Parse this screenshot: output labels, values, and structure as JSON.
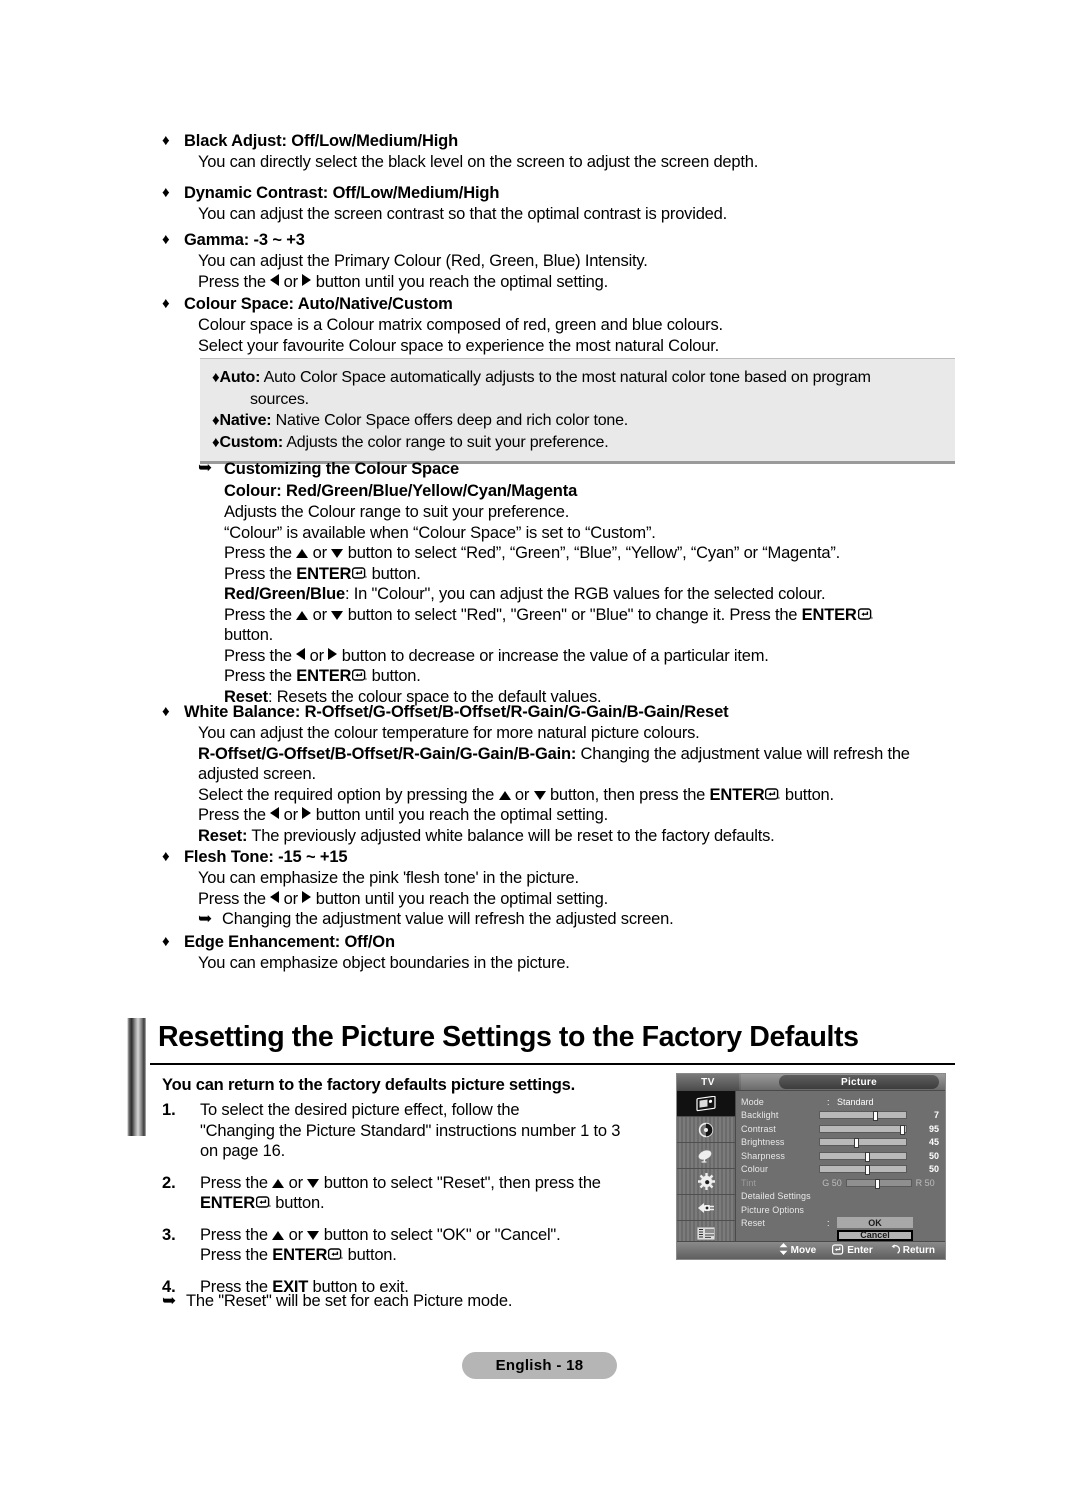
{
  "document": {
    "footer_badge": "English - 18"
  },
  "features": [
    {
      "heading": "Black Adjust: Off/Low/Medium/High",
      "lines": [
        "You can directly select the black level on the screen to adjust the screen depth."
      ]
    },
    {
      "heading": "Dynamic Contrast: Off/Low/Medium/High",
      "lines": [
        "You can adjust the screen contrast so that the optimal contrast is provided."
      ]
    },
    {
      "heading": "Gamma: -3 ~ +3",
      "lines": [
        "You can adjust the Primary Colour (Red, Green, Blue) Intensity."
      ],
      "press_line": {
        "pre": "Press the ",
        "mid": " or ",
        "post": " button until you reach the optimal setting."
      }
    },
    {
      "heading": "Colour Space: Auto/Native/Custom",
      "lines": [
        "Colour space is a Colour matrix composed of red, green and blue colours.",
        "Select your favourite Colour space to experience the most natural Colour."
      ]
    }
  ],
  "colour_space_box": {
    "items": [
      {
        "term": "Auto:",
        "text": " Auto Color Space automatically adjusts to the most natural color tone based on program",
        "cont": "sources."
      },
      {
        "term": "Native:",
        "text": " Native Color Space offers deep and rich color tone."
      },
      {
        "term": "Custom:",
        "text": " Adjusts the color range to suit your preference."
      }
    ]
  },
  "customizing": {
    "title": "Customizing the Colour Space",
    "subtitle": "Colour: Red/Green/Blue/Yellow/Cyan/Magenta",
    "line1": "Adjusts the Colour range to suit your preference.",
    "line2": "“Colour” is available when “Colour Space” is set to “Custom”.",
    "line3_pre": "Press the ",
    "line3_mid": " or ",
    "line3_post": " button to select “Red”, “Green”, “Blue”, “Yellow”, “Cyan” or “Magenta”.",
    "line4_pre": "Press the ",
    "line4_bold": "ENTER",
    "line4_post": " button.",
    "rgb_term": "Red/Green/Blue",
    "rgb_text": ": In \"Colour\", you can adjust the RGB values for the selected colour.",
    "line5_pre": "Press the ",
    "line5_mid": " or ",
    "line5_mid2": " button to select \"Red\", \"Green\" or \"Blue\" to change it. Press the ",
    "line5_bold": "ENTER",
    "line6": "button.",
    "line7_pre": "Press the ",
    "line7_mid": " or ",
    "line7_post": " button to decrease or increase the value of a particular item.",
    "line8_pre": "Press the ",
    "line8_bold": "ENTER",
    "line8_post": " button.",
    "reset_term": "Reset",
    "reset_text": ": Resets the colour space to the default values."
  },
  "white_balance": {
    "heading": "White Balance: R-Offset/G-Offset/B-Offset/R-Gain/G-Gain/B-Gain/Reset",
    "line1": "You can adjust the colour temperature for more natural picture colours.",
    "line2_bold": "R-Offset/G-Offset/B-Offset/R-Gain/G-Gain/B-Gain:",
    "line2_text": " Changing the adjustment value will refresh the",
    "line3": "adjusted screen.",
    "line4_pre": "Select the required option by pressing the ",
    "line4_mid": " or ",
    "line4_mid2": " button, then press the ",
    "line4_bold": "ENTER",
    "line4_post": " button.",
    "line5_pre": "Press the ",
    "line5_mid": " or ",
    "line5_post": " button until you reach the optimal setting.",
    "reset_term": "Reset:",
    "reset_text": " The previously adjusted white balance will be reset to the factory defaults."
  },
  "flesh_tone": {
    "heading": "Flesh Tone: -15 ~ +15",
    "line1": "You can emphasize the pink 'flesh tone' in the picture.",
    "line2_pre": "Press the ",
    "line2_mid": " or ",
    "line2_post": " button until you reach the optimal setting.",
    "note": "Changing the adjustment value will refresh the adjusted screen."
  },
  "edge_enhancement": {
    "heading": "Edge Enhancement: Off/On",
    "line1": "You can emphasize object boundaries in the picture."
  },
  "reset_section": {
    "title": "Resetting the Picture Settings to the Factory Defaults",
    "intro": "You can return to the factory defaults picture settings.",
    "steps": [
      {
        "num": "1.",
        "lines": [
          "To select the desired picture effect, follow the",
          "\"Changing the Picture Standard\" instructions number 1 to 3",
          "on page 16."
        ]
      },
      {
        "num": "2.",
        "l1_pre": "Press the ",
        "l1_mid": " or ",
        "l1_post": " button to select \"Reset\", then press the",
        "l2_bold": "ENTER",
        "l2_post": " button."
      },
      {
        "num": "3.",
        "l1_pre": "Press the ",
        "l1_mid": " or ",
        "l1_post": " button to select \"OK\" or \"Cancel\".",
        "l2_pre": "Press the ",
        "l2_bold": "ENTER",
        "l2_post": " button."
      },
      {
        "num": "4.",
        "l1_pre": "Press the ",
        "l1_bold": "EXIT",
        "l1_post": " button to exit."
      }
    ],
    "final_note": "The \"Reset\" will be set for each Picture mode."
  },
  "osd": {
    "source_label": "TV",
    "menu_title": "Picture",
    "rows": [
      {
        "label": "Mode",
        "type": "value",
        "colon": ":",
        "value": "Standard"
      },
      {
        "label": "Backlight",
        "type": "slider",
        "pos": 62,
        "num": "7"
      },
      {
        "label": "Contrast",
        "type": "slider",
        "pos": 93,
        "num": "95"
      },
      {
        "label": "Brightness",
        "type": "slider",
        "pos": 40,
        "num": "45"
      },
      {
        "label": "Sharpness",
        "type": "slider",
        "pos": 52,
        "num": "50"
      },
      {
        "label": "Colour",
        "type": "slider",
        "pos": 52,
        "num": "50"
      },
      {
        "label": "Tint",
        "type": "tint",
        "left_label": "G",
        "left_num": "50",
        "pos": 45,
        "right_label": "R",
        "right_num": "50"
      },
      {
        "label": "Detailed Settings",
        "type": "plain"
      },
      {
        "label": "Picture Options",
        "type": "plain"
      },
      {
        "label": "Reset",
        "type": "buttons",
        "colon": ":",
        "ok": "OK",
        "cancel": "Cancel"
      }
    ],
    "footer": {
      "move": "Move",
      "enter": "Enter",
      "return": "Return"
    }
  },
  "colors": {
    "box_bg": "#e9e9e9",
    "pill_bg": "#b5b5b5",
    "osd_bg": "#6f6f6f",
    "slider_track": "#b9b9b9"
  }
}
